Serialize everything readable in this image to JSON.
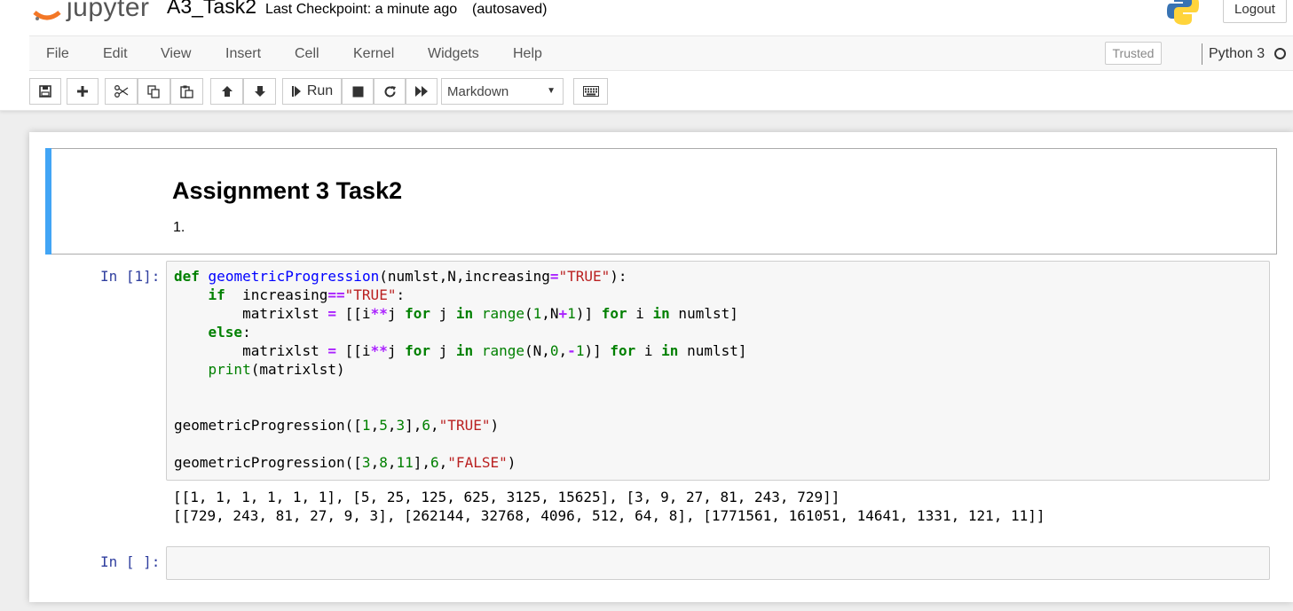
{
  "header": {
    "logo_text": "jupyter",
    "notebook_name": "A3_Task2",
    "checkpoint": "Last Checkpoint: a minute ago",
    "autosave": "(autosaved)",
    "logout_label": "Logout"
  },
  "menubar": {
    "items": [
      "File",
      "Edit",
      "View",
      "Insert",
      "Cell",
      "Kernel",
      "Widgets",
      "Help"
    ],
    "trusted_label": "Trusted",
    "kernel_name": "Python 3"
  },
  "toolbar": {
    "run_label": "Run",
    "cell_type": "Markdown",
    "icons": [
      "save-icon",
      "plus-icon",
      "cut-icon",
      "copy-icon",
      "paste-icon",
      "arrow-up-icon",
      "arrow-down-icon",
      "run-icon",
      "stop-icon",
      "restart-icon",
      "fast-forward-icon",
      "keyboard-icon"
    ]
  },
  "cells": {
    "markdown": {
      "title": "Assignment 3 Task2",
      "text": "1."
    },
    "code1": {
      "prompt": "In [1]:",
      "source": [
        "def geometricProgression(numlst,N,increasing=\"TRUE\"):",
        "    if  increasing==\"TRUE\":",
        "        matrixlst = [[i**j for j in range(1,N+1)] for i in numlst]",
        "    else:",
        "        matrixlst = [[i**j for j in range(N,0,-1)] for i in numlst]",
        "    print(matrixlst)",
        "",
        "",
        "geometricProgression([1,5,3],6,\"TRUE\")",
        "",
        "geometricProgression([3,8,11],6,\"FALSE\")"
      ],
      "output": [
        "[[1, 1, 1, 1, 1, 1], [5, 25, 125, 625, 3125, 15625], [3, 9, 27, 81, 243, 729]]",
        "[[729, 243, 81, 27, 9, 3], [262144, 32768, 4096, 512, 64, 8], [1771561, 161051, 14641, 1331, 121, 11]]"
      ]
    },
    "code2": {
      "prompt": "In [ ]:",
      "source": ""
    }
  },
  "colors": {
    "selected_cell_bar": "#42a5f5",
    "prompt": "#303f9f",
    "keyword": "#008000",
    "string": "#ba2121",
    "function_name": "#0000ff",
    "operator": "#aa22ff"
  }
}
